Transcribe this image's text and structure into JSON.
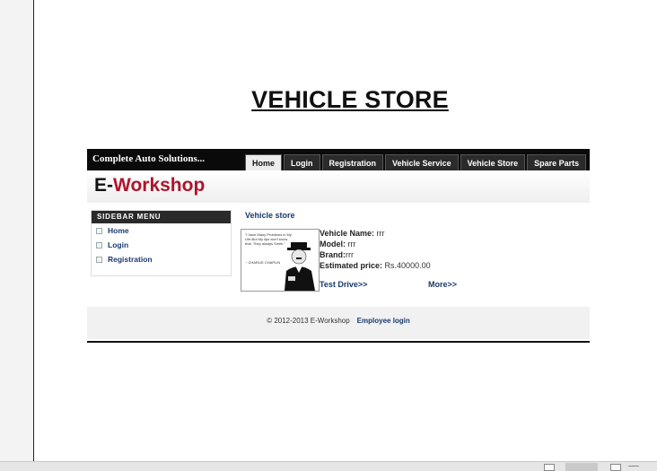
{
  "page": {
    "heading": "VEHICLE STORE"
  },
  "site": {
    "tagline": "Complete Auto Solutions...",
    "logo": {
      "prefix": "E-",
      "name": "Workshop"
    },
    "nav": [
      {
        "label": "Home",
        "active": true
      },
      {
        "label": "Login",
        "active": false
      },
      {
        "label": "Registration",
        "active": false
      },
      {
        "label": "Vehicle Service",
        "active": false
      },
      {
        "label": "Vehicle Store",
        "active": false
      },
      {
        "label": "Spare Parts",
        "active": false
      }
    ],
    "sidebar": {
      "header": "SIDEBAR MENU",
      "items": [
        "Home",
        "Login",
        "Registration"
      ]
    },
    "content": {
      "title": "Vehicle store",
      "image_quote": "\"I have Many Problems in My Life.But My lips don't know that. They always Smile.\"",
      "image_signature": "~ CHARLIE CHAPLIN",
      "vehicle": {
        "name_label": "Vehicle Name:",
        "name": "rrr",
        "model_label": "Model:",
        "model": "rrr",
        "brand_label": "Brand:",
        "brand": "rrr",
        "price_label": "Estimated price:",
        "price": "Rs.40000.00"
      },
      "test_drive": "Test Drive>>",
      "more": "More>>"
    },
    "footer": {
      "copyright": "© 2012-2013 E-Workshop",
      "employee_login": "Employee login"
    }
  }
}
